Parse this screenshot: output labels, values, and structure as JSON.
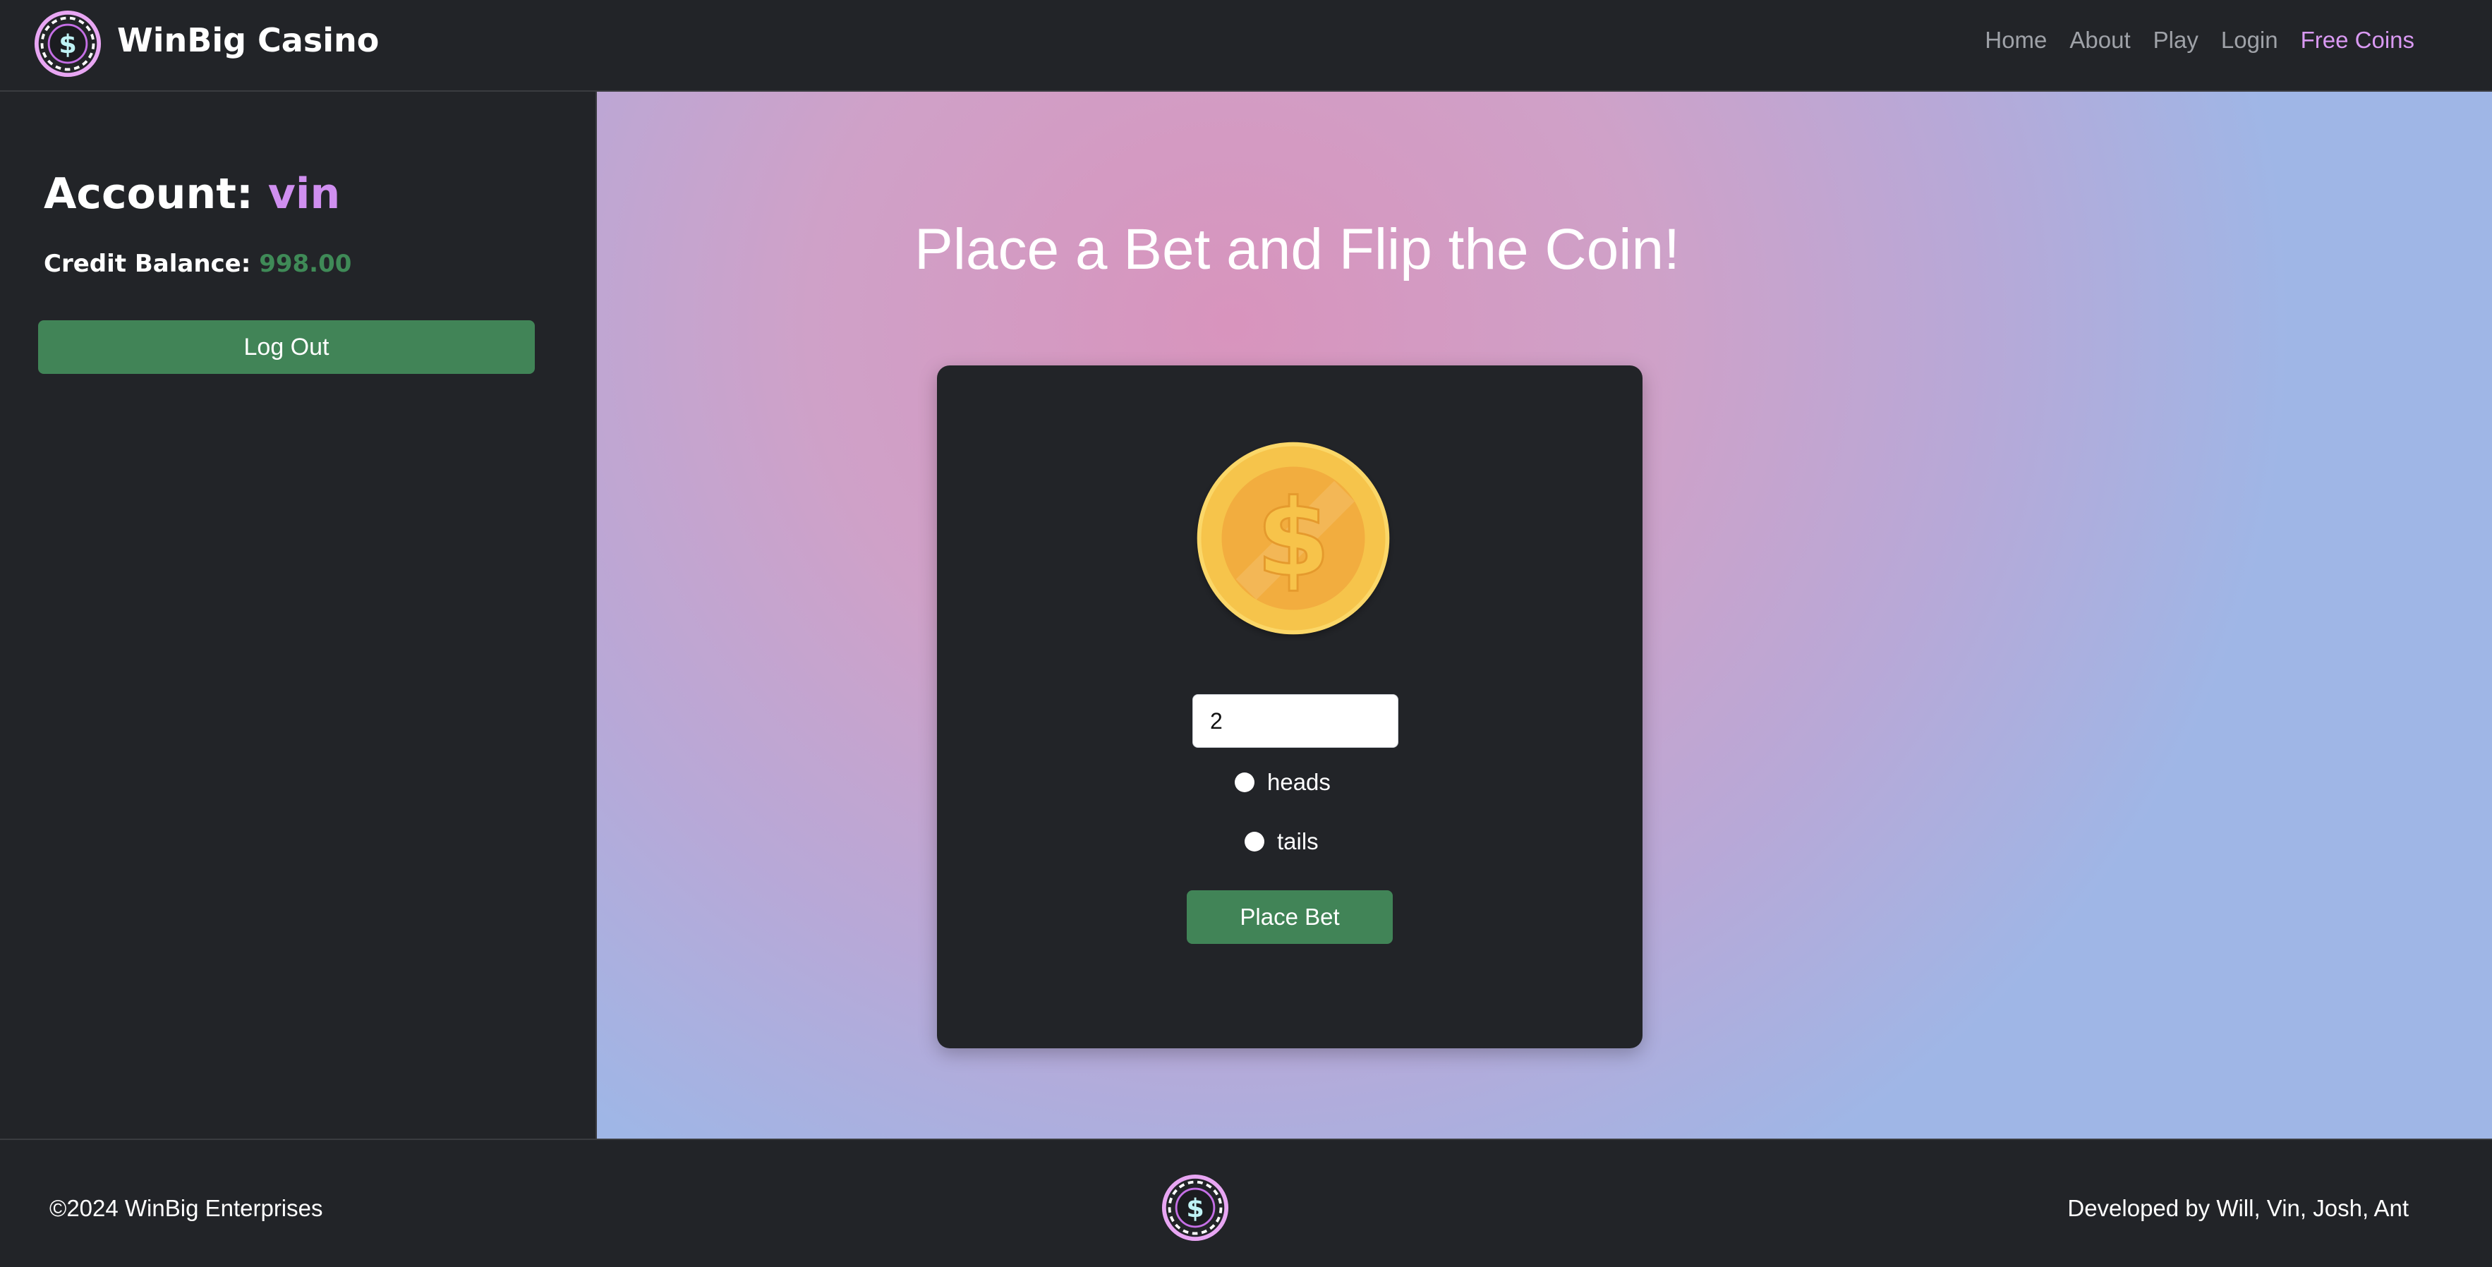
{
  "header": {
    "brand": "WinBig Casino",
    "nav": [
      "Home",
      "About",
      "Play",
      "Login",
      "Free Coins"
    ],
    "logo_icon": "casino-chip-dollar-icon"
  },
  "sidebar": {
    "account_label": "Account:",
    "username": "vin",
    "credit_label": "Credit Balance:",
    "credit_value": "998.00",
    "logout_label": "Log Out"
  },
  "main": {
    "headline": "Place a Bet and Flip the Coin!",
    "coin_icon": "gold-dollar-coin-icon",
    "bet_value": "2",
    "options": [
      "heads",
      "tails"
    ],
    "place_label": "Place Bet"
  },
  "footer": {
    "copyright": "©2024 WinBig Enterprises",
    "developers": "Developed by Will, Vin, Josh, Ant"
  },
  "colors": {
    "accent_purple": "#d08ff0",
    "button_green": "#418457",
    "balance_green": "#3f8a57",
    "panel_dark": "#222428"
  }
}
